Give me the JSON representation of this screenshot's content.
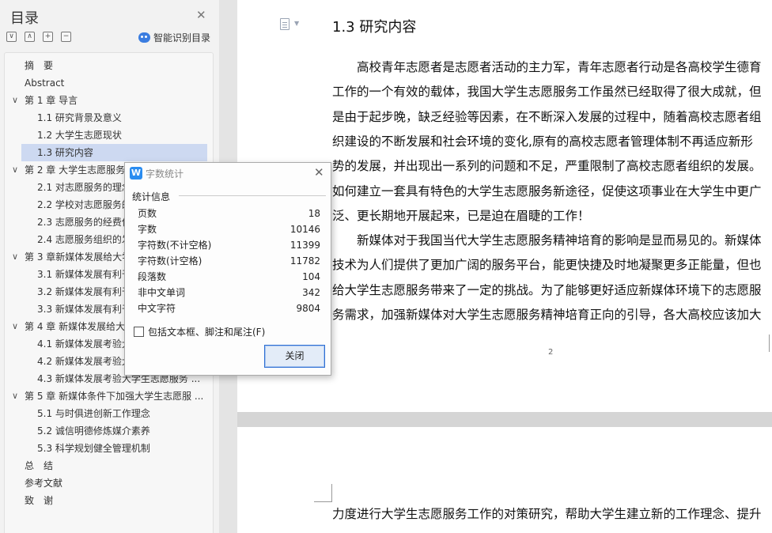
{
  "sidebar": {
    "title": "目录",
    "smart_toc_label": "智能识别目录",
    "tools": [
      "∨",
      "∧",
      "+",
      "−"
    ],
    "items": [
      {
        "label": "摘　要",
        "level": 0,
        "expanded": null,
        "active": false
      },
      {
        "label": "Abstract",
        "level": 0,
        "expanded": null,
        "active": false
      },
      {
        "label": "第 1 章  导言",
        "level": 0,
        "expanded": true,
        "active": false
      },
      {
        "label": "1.1 研究背景及意义",
        "level": 1,
        "expanded": null,
        "active": false
      },
      {
        "label": "1.2 大学生志愿现状",
        "level": 1,
        "expanded": null,
        "active": false
      },
      {
        "label": "1.3 研究内容",
        "level": 1,
        "expanded": null,
        "active": true
      },
      {
        "label": "第 2 章  大学生志愿服务",
        "level": 0,
        "expanded": true,
        "active": false
      },
      {
        "label": "2.1 对志愿服务的理念",
        "level": 1,
        "expanded": null,
        "active": false
      },
      {
        "label": "2.2 学校对志愿服务的",
        "level": 1,
        "expanded": null,
        "active": false
      },
      {
        "label": "2.3 志愿服务的经费保",
        "level": 1,
        "expanded": null,
        "active": false
      },
      {
        "label": "2.4 志愿服务组织的发",
        "level": 1,
        "expanded": null,
        "active": false
      },
      {
        "label": "第 3 章新媒体发展给大学",
        "level": 0,
        "expanded": true,
        "active": false
      },
      {
        "label": "3.1 新媒体发展有利于",
        "level": 1,
        "expanded": null,
        "active": false
      },
      {
        "label": "3.2 新媒体发展有利于",
        "level": 1,
        "expanded": null,
        "active": false
      },
      {
        "label": "3.3 新媒体发展有利于",
        "level": 1,
        "expanded": null,
        "active": false
      },
      {
        "label": "第 4 章  新媒体发展给大",
        "level": 0,
        "expanded": true,
        "active": false
      },
      {
        "label": "4.1 新媒体发展考验大",
        "level": 1,
        "expanded": null,
        "active": false
      },
      {
        "label": "4.2 新媒体发展考验大",
        "level": 1,
        "expanded": null,
        "active": false
      },
      {
        "label": "4.3 新媒体发展考验大学生志愿服务 ...",
        "level": 1,
        "expanded": null,
        "active": false
      },
      {
        "label": "第 5 章  新媒体条件下加强大学生志愿服 ...",
        "level": 0,
        "expanded": true,
        "active": false
      },
      {
        "label": "5.1 与时俱进创新工作理念",
        "level": 1,
        "expanded": null,
        "active": false
      },
      {
        "label": "5.2 诚信明德修炼媒介素养",
        "level": 1,
        "expanded": null,
        "active": false
      },
      {
        "label": "5.3 科学规划健全管理机制",
        "level": 1,
        "expanded": null,
        "active": false
      },
      {
        "label": "总　结",
        "level": 0,
        "expanded": null,
        "active": false
      },
      {
        "label": "参考文献",
        "level": 0,
        "expanded": null,
        "active": false
      },
      {
        "label": "致　谢",
        "level": 0,
        "expanded": null,
        "active": false
      }
    ]
  },
  "document": {
    "heading": "1.3 研究内容",
    "page1_lines": [
      "　　高校青年志愿者是志愿者活动的主力军，青年志愿者行动是各高校学生德育",
      "工作的一个有效的载体，我国大学生志愿服务工作虽然已经取得了很大成就，但",
      "是由于起步晚，缺乏经验等因素，在不断深入发展的过程中，随着高校志愿者组",
      "织建设的不断发展和社会环境的变化,原有的高校志愿者管理体制不再适应新形",
      "势的发展，并出现出一系列的问题和不足，严重限制了高校志愿者组织的发展。",
      "如何建立一套具有特色的大学生志愿服务新途径，促使这项事业在大学生中更广",
      "泛、更长期地开展起来，已是迫在眉睫的工作！",
      "　　新媒体对于我国当代大学生志愿服务精神培育的影响是显而易见的。新媒体",
      "技术为人们提供了更加广阔的服务平台，能更快捷及时地凝聚更多正能量，但也",
      "给大学生志愿服务带来了一定的挑战。为了能够更好适应新媒体环境下的志愿服",
      "务需求，加强新媒体对大学生志愿服务精神培育正向的引导，各大高校应该加大"
    ],
    "page_number": "2",
    "page2_lines": [
      "力度进行大学生志愿服务工作的对策研究，帮助大学生建立新的工作理念、提升"
    ]
  },
  "dialog": {
    "title": "字数统计",
    "section": "统计信息",
    "stats": [
      {
        "label": "页数",
        "value": "18"
      },
      {
        "label": "字数",
        "value": "10146"
      },
      {
        "label": "字符数(不计空格)",
        "value": "11399"
      },
      {
        "label": "字符数(计空格)",
        "value": "11782"
      },
      {
        "label": "段落数",
        "value": "104"
      },
      {
        "label": "非中文单词",
        "value": "342"
      },
      {
        "label": "中文字符",
        "value": "9804"
      }
    ],
    "checkbox_label": "包括文本框、脚注和尾注(F)",
    "checkbox_checked": false,
    "close_label": "关闭"
  },
  "colors": {
    "accent": "#2e6fd3",
    "toc_active": "#cdd9f1",
    "app_icon": "#2a8cf0"
  }
}
